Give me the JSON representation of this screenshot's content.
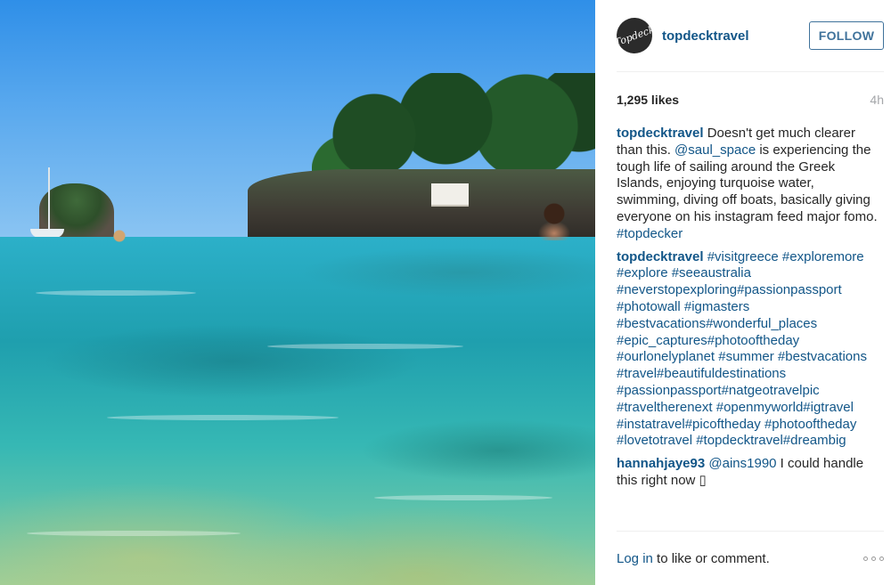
{
  "post": {
    "author": "topdecktravel",
    "avatar_text": "Topdeck",
    "follow_label": "FOLLOW",
    "likes": "1,295 likes",
    "time": "4h",
    "caption": {
      "user": "topdecktravel",
      "text_1": " Doesn't get much clearer than this. ",
      "mention": "@saul_space",
      "text_2": " is experiencing the tough life of sailing around the Greek Islands, enjoying turquoise water, swimming, diving off boats, basically giving everyone on his instagram feed major fomo. ",
      "tag": "#topdecker"
    },
    "hashtag_comment": {
      "user": "topdecktravel",
      "tags": " #visitgreece #exploremore #explore #seeaustralia #neverstopexploring#passionpassport #photowall #igmasters #bestvacations#wonderful_places #epic_captures#photooftheday #ourlonelyplanet #summer #bestvacations #travel#beautifuldestinations #passionpassport#natgeotravelpic #traveltherenext #openmyworld#igtravel #instatravel#picoftheday #photooftheday #lovetotravel #topdecktravel#dreambig"
    },
    "reply": {
      "user": "hannahjaye93",
      "mention": "@ains1990",
      "text": " I could handle this right now ",
      "emoji": "▯"
    },
    "footer": {
      "login_label": "Log in",
      "rest": " to like or comment."
    }
  },
  "colors": {
    "link": "#125688",
    "follow_border": "#3f729b",
    "muted": "#a5a7aa"
  },
  "icons": {
    "more": "more-options-icon"
  }
}
